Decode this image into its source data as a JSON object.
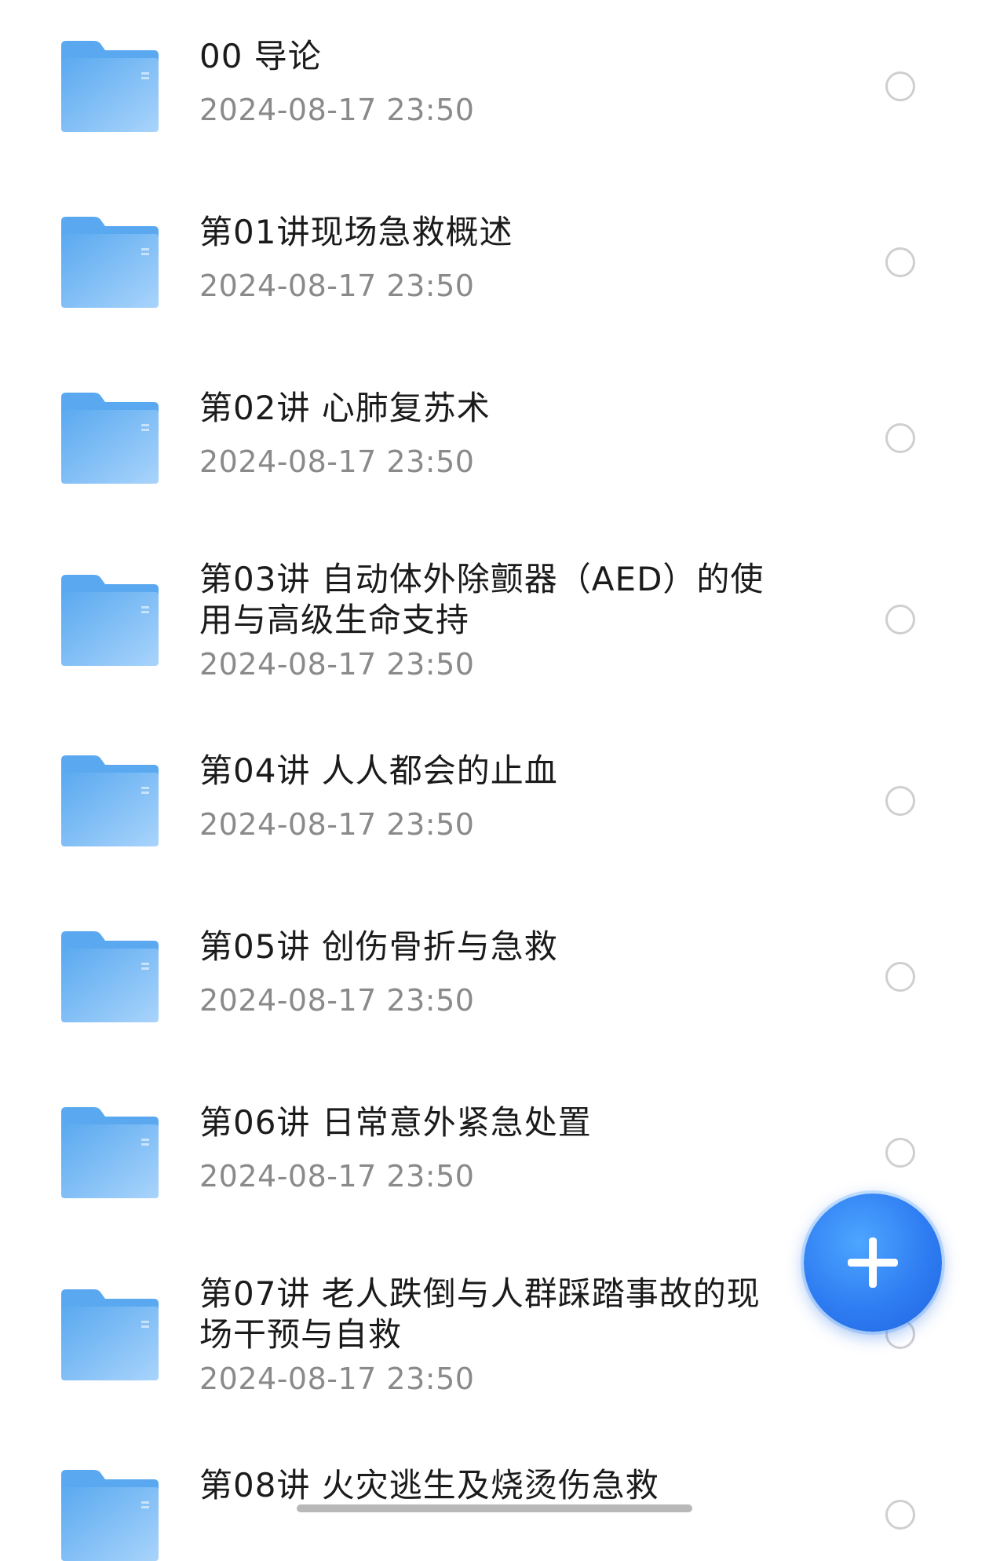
{
  "items": [
    {
      "title": "00 导论",
      "date": "2024-08-17 23:50"
    },
    {
      "title": "第01讲现场急救概述",
      "date": "2024-08-17 23:50"
    },
    {
      "title": "第02讲 心肺复苏术",
      "date": "2024-08-17 23:50"
    },
    {
      "title": "第03讲 自动体外除颤器（AED）的使用与高级生命支持",
      "date": "2024-08-17 23:50"
    },
    {
      "title": "第04讲 人人都会的止血",
      "date": "2024-08-17 23:50"
    },
    {
      "title": "第05讲 创伤骨折与急救",
      "date": "2024-08-17 23:50"
    },
    {
      "title": "第06讲 日常意外紧急处置",
      "date": "2024-08-17 23:50"
    },
    {
      "title": "第07讲 老人跌倒与人群踩踏事故的现场干预与自救",
      "date": "2024-08-17 23:50"
    },
    {
      "title": "第08讲 火灾逃生及烧烫伤急救",
      "date": ""
    }
  ],
  "icons": {
    "folder": "folder-icon",
    "radio": "radio-unchecked-icon",
    "fab": "plus-icon"
  },
  "colors": {
    "folder_back": "#5aa9f0",
    "folder_front": "#a9d4fb",
    "fab": "#2f7df2",
    "date_text": "#8a8a8a"
  }
}
